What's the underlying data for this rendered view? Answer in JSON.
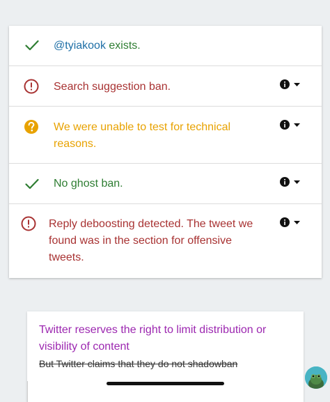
{
  "results": [
    {
      "status": "success",
      "handle": "@tyiakook",
      "text": " exists.",
      "has_info": false
    },
    {
      "status": "error",
      "text": "Search suggestion ban.",
      "has_info": true
    },
    {
      "status": "unknown",
      "text_lines": [
        "We were unable to test for technical",
        "reasons."
      ],
      "has_info": true
    },
    {
      "status": "success",
      "text": "No ghost ban.",
      "has_info": true
    },
    {
      "status": "error",
      "text_lines": [
        "Reply deboosting detected. The tweet we",
        "found was in the section for offensive",
        "tweets."
      ],
      "has_info": true
    }
  ],
  "disclaimer": {
    "lines": [
      "Twitter reserves the right to limit distribution or",
      "visibility of content"
    ],
    "strikethrough": "But Twitter claims that they do not shadowban"
  },
  "colors": {
    "success": "#2e7d32",
    "error": "#a83232",
    "unknown": "#e8a200",
    "handle": "#1e6fa6",
    "disclaimer": "#9c27b0"
  },
  "icons": {
    "success": "check-icon",
    "error": "alert-circle-icon",
    "unknown": "help-circle-icon",
    "info": "info-icon",
    "dropdown": "caret-down-icon"
  }
}
